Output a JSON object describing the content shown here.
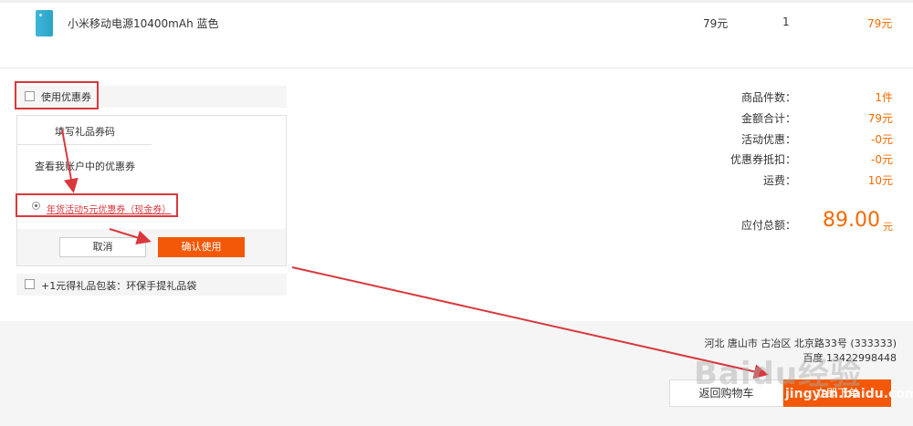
{
  "product": {
    "name": "小米移动电源10400mAh 蓝色",
    "price": "79元",
    "qty": "1",
    "subtotal": "79元"
  },
  "coupon": {
    "use_label": "使用优惠券",
    "tab_label": "填写礼品券码",
    "account_label": "查看我账户中的优惠券",
    "option_label": "年货活动5元优惠券（现金券）",
    "cancel": "取消",
    "confirm": "确认使用"
  },
  "gift_wrap_label": "+1元得礼品包装：环保手提礼品袋",
  "summary": {
    "items": [
      {
        "label": "商品件数：",
        "value": "1件"
      },
      {
        "label": "金额合计：",
        "value": "79元"
      },
      {
        "label": "活动优惠：",
        "value": "-0元"
      },
      {
        "label": "优惠券抵扣：",
        "value": "-0元"
      },
      {
        "label": "运费：",
        "value": "10元"
      }
    ],
    "total_label": "应付总额：",
    "total_value": "89.00",
    "total_unit": "元"
  },
  "shipping": {
    "address": "河北 唐山市 古冶区 北京路33号 (333333)",
    "contact": "百度 13422998448"
  },
  "actions": {
    "back": "返回购物车",
    "order": "立即下单"
  },
  "watermark": "Baidu经验",
  "watermark_url": "jingyan.baidu.com",
  "colors": {
    "accent": "#f25807",
    "price": "#f56a00",
    "annotation": "#d9383d"
  }
}
